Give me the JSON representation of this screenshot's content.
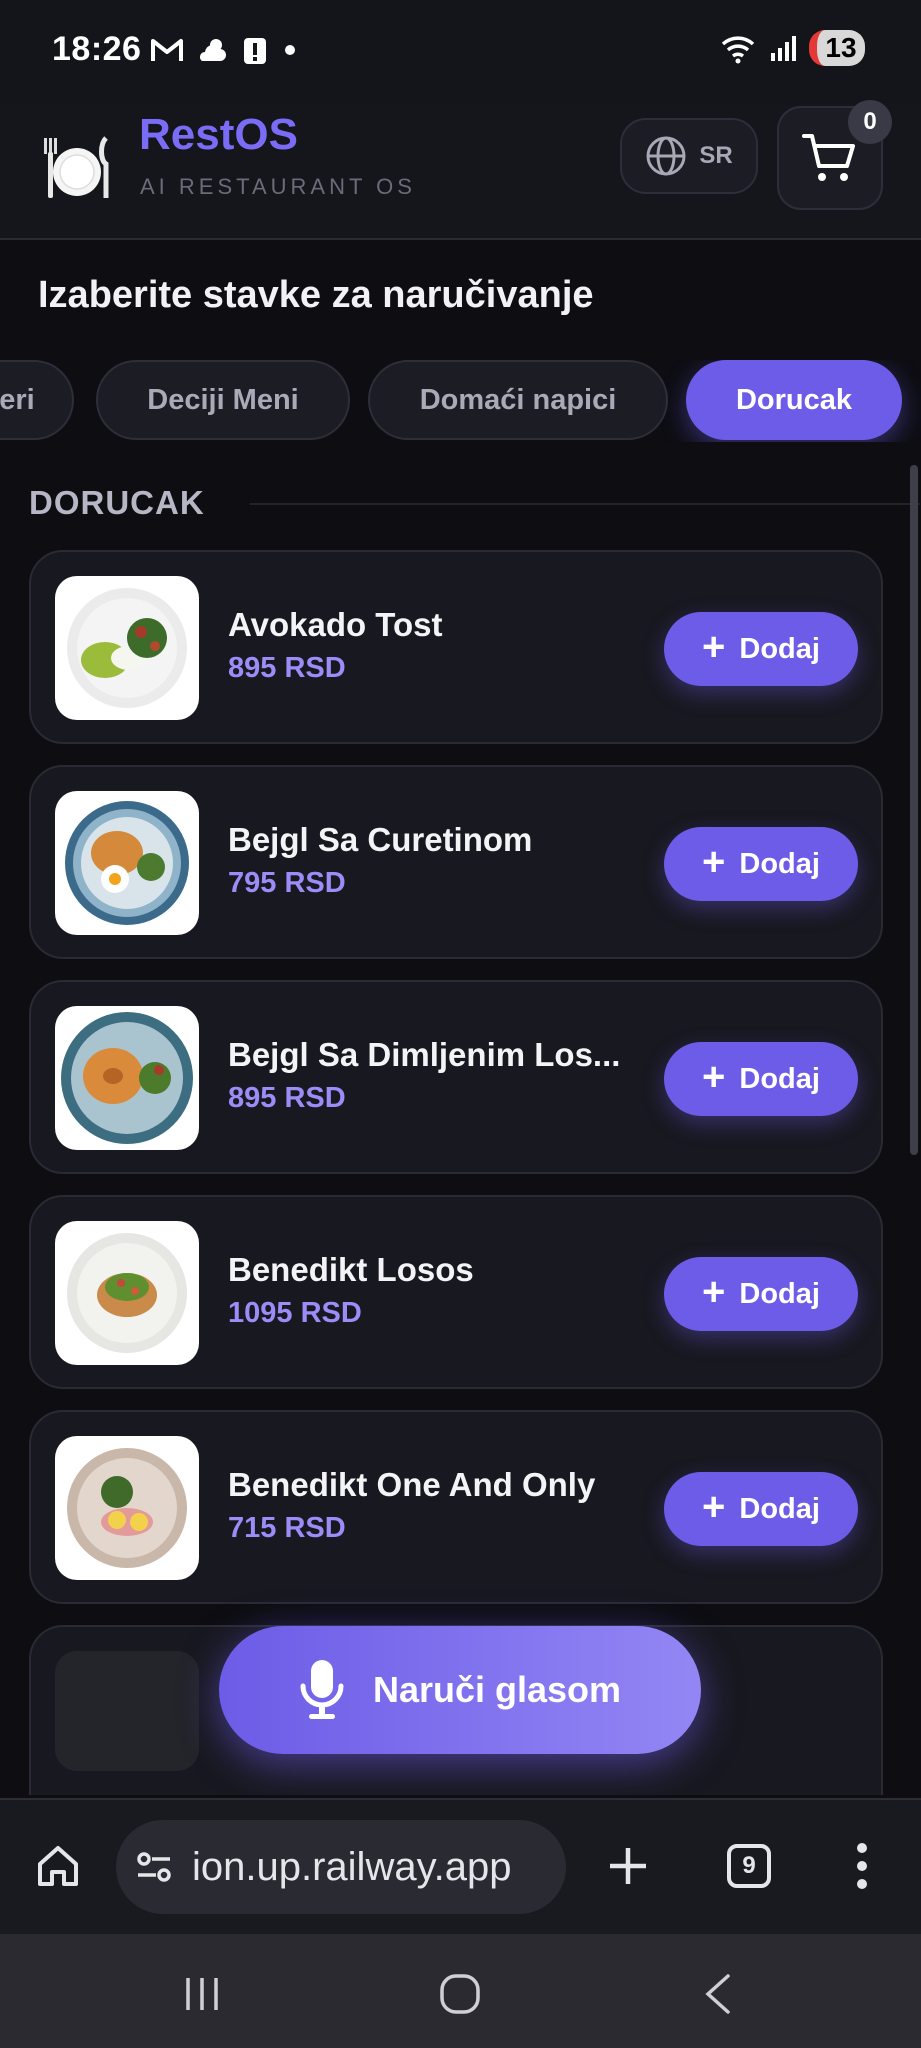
{
  "status_bar": {
    "time": "18:26",
    "battery": "13",
    "icons": [
      "gmail-icon",
      "weather-icon",
      "alert-icon",
      "dot-icon",
      "wifi-icon",
      "signal-icon"
    ]
  },
  "header": {
    "brand": "RestOS",
    "tagline": "AI RESTAURANT OS",
    "language": "SR",
    "cart_count": "0"
  },
  "page": {
    "heading": "Izaberite stavke za naručivanje"
  },
  "categories": [
    {
      "label": "eri",
      "active": false
    },
    {
      "label": "Deciji Meni",
      "active": false
    },
    {
      "label": "Domaći napici",
      "active": false
    },
    {
      "label": "Dorucak",
      "active": true
    }
  ],
  "section": {
    "title": "DORUCAK"
  },
  "items": [
    {
      "name": "Avokado Tost",
      "price": "895 RSD",
      "add_label": "Dodaj"
    },
    {
      "name": "Bejgl Sa Curetinom",
      "price": "795 RSD",
      "add_label": "Dodaj"
    },
    {
      "name": "Bejgl Sa Dimljenim Los...",
      "price": "895 RSD",
      "add_label": "Dodaj"
    },
    {
      "name": "Benedikt Losos",
      "price": "1095 RSD",
      "add_label": "Dodaj"
    },
    {
      "name": "Benedikt One And Only",
      "price": "715 RSD",
      "add_label": "Dodaj"
    }
  ],
  "voice": {
    "label": "Naruči glasom"
  },
  "browser": {
    "url": "ion.up.railway.app",
    "tabs": "9"
  },
  "colors": {
    "accent": "#6c5ce7",
    "price": "#9a8df8",
    "background": "#0d0d12"
  }
}
